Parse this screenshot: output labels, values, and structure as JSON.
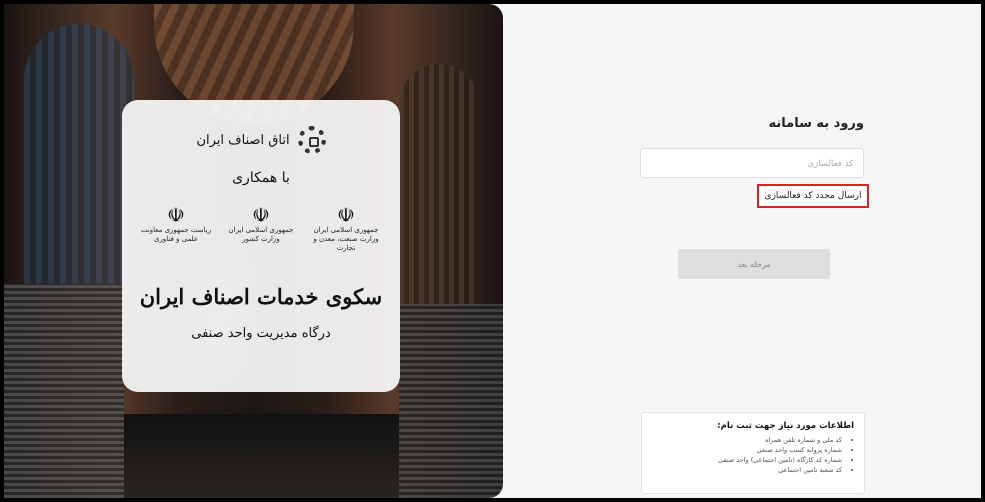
{
  "brand": {
    "chamber_name": "اتاق اصناف ایران",
    "with_label": "با همکاری",
    "emblems": [
      {
        "caption": "ریاست جمهوری معاونت علمی و فناوری"
      },
      {
        "caption": "جمهوری اسلامی ایران وزارت کشور"
      },
      {
        "caption": "جمهوری اسلامی ایران وزارت صنعت، معدن و تجارت"
      }
    ],
    "platform_title": "سکوی خدمات اصناف ایران",
    "portal_subtitle": "درگاه مدیریت واحد صنفی"
  },
  "login": {
    "title": "ورود به سامانه",
    "activation_placeholder": "کد فعالسازی",
    "resend_label": "ارسال مجدد کد فعالسازی",
    "next_label": "مرحله بعد"
  },
  "info": {
    "heading": "اطلاعات مورد نیاز جهت ثبت نام:",
    "items": [
      "کد ملی و شماره تلفن همراه",
      "شماره پروانه کسب واحد صنفی",
      "شماره کد کارگاه (تامین اجتماعی) واحد صنفی",
      "کد شعبه تامین اجتماعی"
    ]
  },
  "colors": {
    "highlight": "#dd2222",
    "button_disabled": "#dedede"
  }
}
